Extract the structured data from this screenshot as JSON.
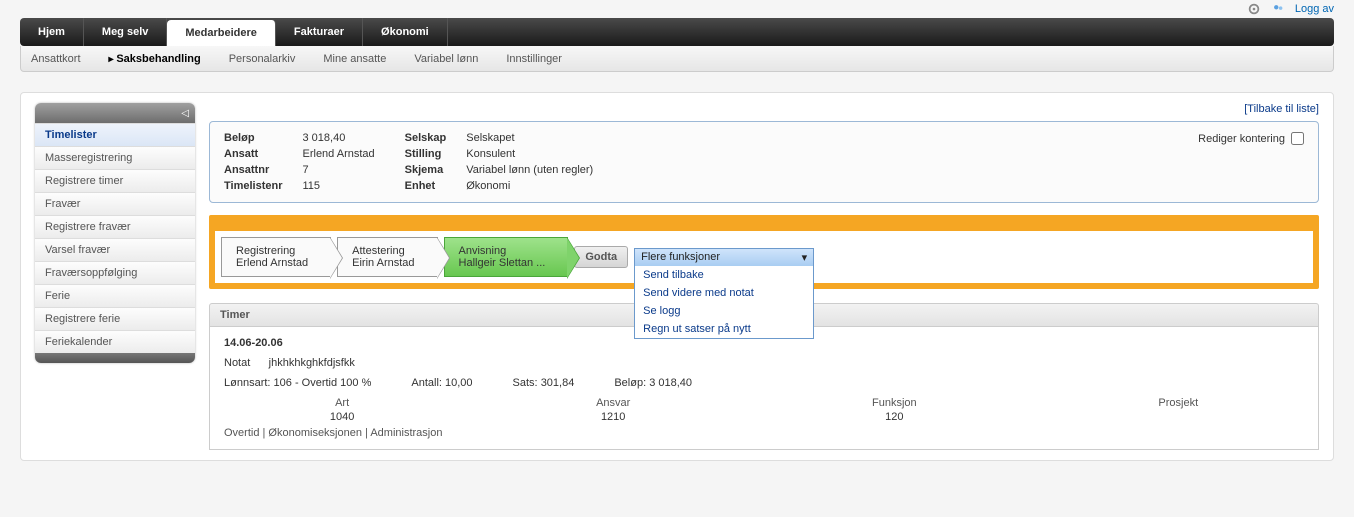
{
  "top_right": {
    "logout": "Logg av"
  },
  "mainnav": {
    "tabs": [
      {
        "label": "Hjem"
      },
      {
        "label": "Meg selv"
      },
      {
        "label": "Medarbeidere"
      },
      {
        "label": "Fakturaer"
      },
      {
        "label": "Økonomi"
      }
    ],
    "active_index": 2
  },
  "subnav": {
    "items": [
      {
        "label": "Ansattkort"
      },
      {
        "label": "Saksbehandling"
      },
      {
        "label": "Personalarkiv"
      },
      {
        "label": "Mine ansatte"
      },
      {
        "label": "Variabel lønn"
      },
      {
        "label": "Innstillinger"
      }
    ],
    "active_index": 1
  },
  "sidebar": {
    "items": [
      {
        "label": "Timelister"
      },
      {
        "label": "Masseregistrering"
      },
      {
        "label": "Registrere timer"
      },
      {
        "label": "Fravær"
      },
      {
        "label": "Registrere fravær"
      },
      {
        "label": "Varsel fravær"
      },
      {
        "label": "Fraværsoppfølging"
      },
      {
        "label": "Ferie"
      },
      {
        "label": "Registrere ferie"
      },
      {
        "label": "Feriekalender"
      }
    ],
    "active_index": 0
  },
  "back_link": "[Tilbake til liste]",
  "info": {
    "col1": {
      "belop_lbl": "Beløp",
      "belop": "3 018,40",
      "ansatt_lbl": "Ansatt",
      "ansatt": "Erlend Arnstad",
      "ansattnr_lbl": "Ansattnr",
      "ansattnr": "7",
      "timelistenr_lbl": "Timelistenr",
      "timelistenr": "115"
    },
    "col2": {
      "selskap_lbl": "Selskap",
      "selskap": "Selskapet",
      "stilling_lbl": "Stilling",
      "stilling": "Konsulent",
      "skjema_lbl": "Skjema",
      "skjema": "Variabel lønn (uten regler)",
      "enhet_lbl": "Enhet",
      "enhet": "Økonomi"
    },
    "edit_kont_label": "Rediger kontering"
  },
  "steps": {
    "list": [
      {
        "title": "Registrering",
        "who": "Erlend Arnstad"
      },
      {
        "title": "Attestering",
        "who": "Eirin Arnstad"
      },
      {
        "title": "Anvisning",
        "who": "Hallgeir Slettan ..."
      }
    ],
    "green_index": 2,
    "accept_btn": "Godta",
    "dropdown": {
      "label": "Flere funksjoner",
      "options": [
        "Send tilbake",
        "Send videre med notat",
        "Se logg",
        "Regn ut satser på nytt"
      ]
    }
  },
  "timer": {
    "title": "Timer",
    "date": "14.06-20.06",
    "notat_lbl": "Notat",
    "notat": "jhkhkhkghkfdjsfkk",
    "lonnsart_lbl": "Lønnsart:",
    "lonnsart": "106 - Overtid 100 %",
    "antall_lbl": "Antall:",
    "antall": "10,00",
    "sats_lbl": "Sats:",
    "sats": "301,84",
    "belop_lbl": "Beløp:",
    "belop": "3 018,40",
    "art_h": "Art",
    "art_v": "1040",
    "ansvar_h": "Ansvar",
    "ansvar_v": "1210",
    "funksjon_h": "Funksjon",
    "funksjon_v": "120",
    "prosjekt_h": "Prosjekt",
    "prosjekt_v": "",
    "trail": "Overtid | Økonomiseksjonen | Administrasjon"
  }
}
